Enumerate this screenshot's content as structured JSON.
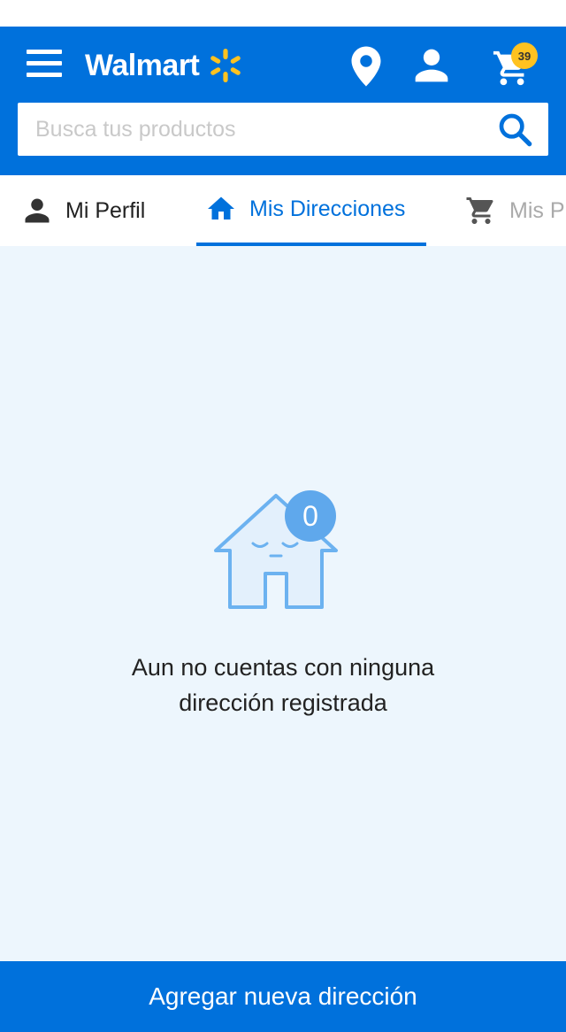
{
  "header": {
    "logo_text": "Walmart",
    "cart_count": "39",
    "brand_color": "#0071dc",
    "spark_color": "#ffc220"
  },
  "search": {
    "value": "",
    "placeholder": "Busca tus productos"
  },
  "tabs": [
    {
      "label": "Mi Perfil",
      "icon": "person-icon",
      "active": false
    },
    {
      "label": "Mis Direcciones",
      "icon": "home-icon",
      "active": true
    },
    {
      "label": "Mis P",
      "icon": "cart-icon",
      "active": false
    }
  ],
  "empty_state": {
    "count": "0",
    "line1": "Aun no cuentas con ninguna",
    "line2": "dirección registrada"
  },
  "footer": {
    "add_label": "Agregar nueva dirección"
  }
}
